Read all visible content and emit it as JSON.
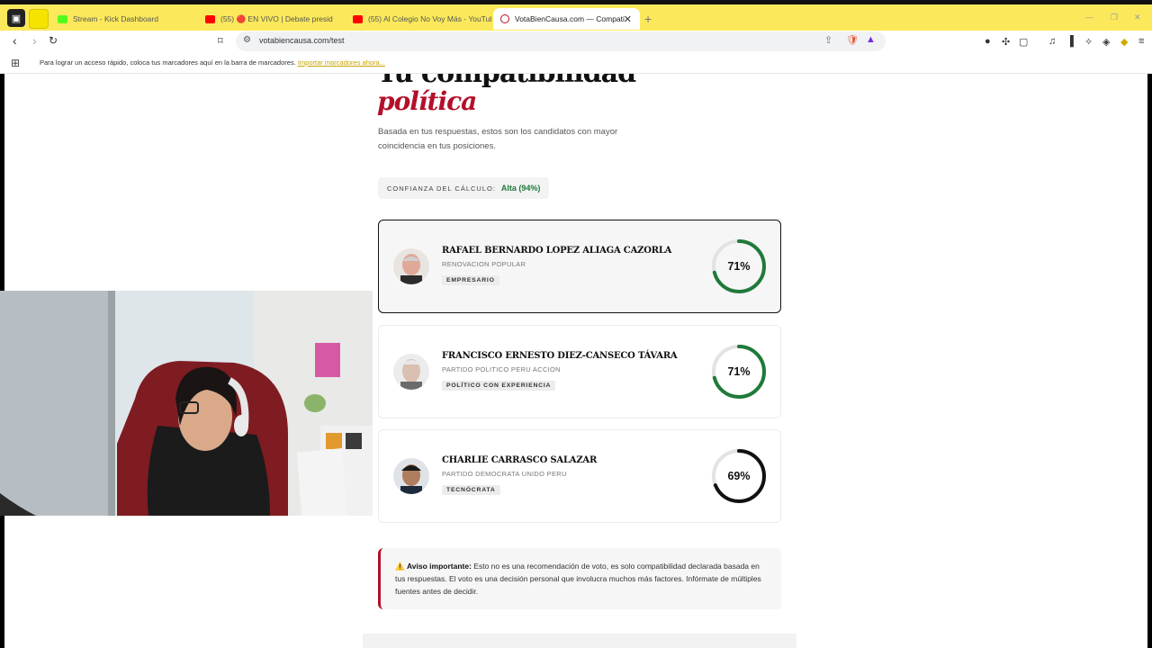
{
  "browser": {
    "tabs": [
      {
        "label": "Stream - Kick Dashboard",
        "favicon": "kick-icon",
        "color": "#53fc18"
      },
      {
        "label": "(55) 🔴 EN VIVO | Debate presid",
        "favicon": "youtube-icon",
        "color": "#ff0000"
      },
      {
        "label": "(55) Al Colegio No Voy Más - YouTub",
        "favicon": "youtube-icon",
        "color": "#ff0000"
      },
      {
        "label": "VotaBienCausa.com — Compati",
        "favicon": "vote-icon",
        "color": "#b3102a",
        "active": true
      }
    ],
    "url": "votabiencausa.com/test",
    "bookmarks_message": "Para lograr un acceso rápido, coloca tus marcadores aquí en la barra de marcadores.",
    "bookmarks_link": "Importar marcadores ahora..."
  },
  "page": {
    "title_line1": "Tu compatibilidad",
    "title_line2": "política",
    "subtitle": "Basada en tus respuestas, estos son los candidatos con mayor coincidencia en tus posiciones.",
    "confidence": {
      "label": "CONFIANZA DEL CÁLCULO:",
      "value": "Alta (94%)"
    },
    "candidates": [
      {
        "name": "RAFAEL BERNARDO LOPEZ ALIAGA CAZORLA",
        "party": "RENOVACION POPULAR",
        "tag": "EMPRESARIO",
        "score": 71,
        "score_label": "71%",
        "ring_color": "#1f7a3a",
        "selected": true
      },
      {
        "name": "FRANCISCO ERNESTO DIEZ-CANSECO TÁVARA",
        "party": "PARTIDO POLITICO PERU ACCION",
        "tag": "POLÍTICO CON EXPERIENCIA",
        "score": 71,
        "score_label": "71%",
        "ring_color": "#1f7a3a",
        "selected": false
      },
      {
        "name": "CHARLIE CARRASCO SALAZAR",
        "party": "PARTIDO DEMOCRATA UNIDO PERU",
        "tag": "TECNÓCRATA",
        "score": 69,
        "score_label": "69%",
        "ring_color": "#111111",
        "selected": false
      }
    ],
    "notice": {
      "emoji": "⚠️",
      "title": "Aviso importante:",
      "text": "Esto no es una recomendación de voto, es solo compatibilidad declarada basada en tus respuestas. El voto es una decisión personal que involucra muchos más factores. Infórmate de múltiples fuentes antes de decidir."
    }
  },
  "colors": {
    "accent": "#b3102a",
    "success": "#1f7a3a",
    "tabbar": "#fbe95b"
  }
}
